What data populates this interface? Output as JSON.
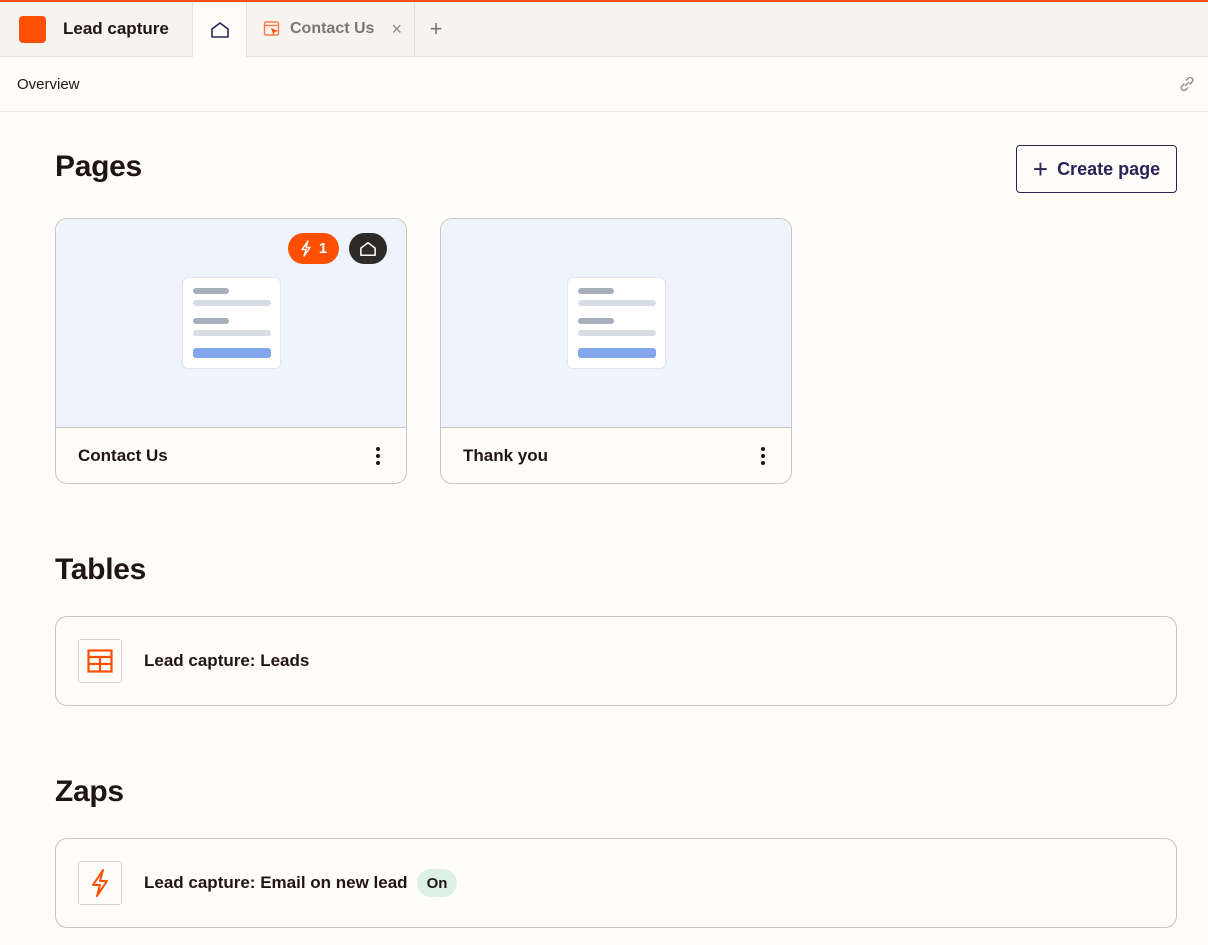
{
  "app": {
    "title": "Lead capture"
  },
  "tabs": [
    {
      "icon": "home-icon"
    },
    {
      "icon": "page-icon",
      "label": "Contact Us",
      "close": "×"
    }
  ],
  "add_tab": "+",
  "subheader": {
    "title": "Overview",
    "icon": "link-icon"
  },
  "pages": {
    "heading": "Pages",
    "create_label": "Create page",
    "create_icon": "+",
    "cards": [
      {
        "name": "Contact Us",
        "zap_count": "1",
        "is_home": true
      },
      {
        "name": "Thank you"
      }
    ]
  },
  "tables": {
    "heading": "Tables",
    "items": [
      {
        "label": "Lead capture: Leads",
        "icon": "table-icon"
      }
    ]
  },
  "zaps": {
    "heading": "Zaps",
    "items": [
      {
        "label": "Lead capture: Email on new lead",
        "status": "On",
        "icon": "zap-icon"
      }
    ]
  },
  "colors": {
    "accent": "#ff4f00",
    "navy": "#2b2358",
    "preview_bg": "#eef3fd",
    "status_on": "#dcf0e4"
  }
}
